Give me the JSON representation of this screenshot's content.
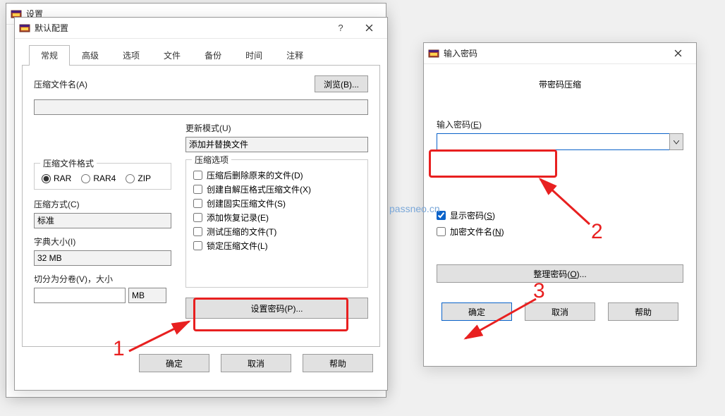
{
  "watermark": "passneo.cn",
  "settings_window": {
    "title": "设置"
  },
  "default_window": {
    "title": "默认配置",
    "tabs": [
      "常规",
      "高级",
      "选项",
      "文件",
      "备份",
      "时间",
      "注释"
    ],
    "active_tab": 0,
    "archive_name_label": "压缩文件名(A)",
    "browse_btn": "浏览(B)...",
    "update_mode_label": "更新模式(U)",
    "update_mode_value": "添加并替换文件",
    "format_legend": "压缩文件格式",
    "formats": [
      "RAR",
      "RAR4",
      "ZIP"
    ],
    "format_selected": "RAR",
    "method_label": "压缩方式(C)",
    "method_value": "标准",
    "dict_label": "字典大小(I)",
    "dict_value": "32 MB",
    "split_label": "切分为分卷(V)，大小",
    "split_unit": "MB",
    "options_legend": "压缩选项",
    "options": [
      "压缩后删除原来的文件(D)",
      "创建自解压格式压缩文件(X)",
      "创建固实压缩文件(S)",
      "添加恢复记录(E)",
      "测试压缩的文件(T)",
      "锁定压缩文件(L)"
    ],
    "set_password_btn": "设置密码(P)...",
    "ok_btn": "确定",
    "cancel_btn": "取消",
    "help_btn": "帮助"
  },
  "pwd_window": {
    "title": "输入密码",
    "heading": "带密码压缩",
    "enter_label_prefix": "输入密码(",
    "enter_label_u": "E",
    "enter_label_suffix": ")",
    "show_prefix": "显示密码(",
    "show_u": "S",
    "show_suffix": ")",
    "encrypt_prefix": "加密文件名(",
    "encrypt_u": "N",
    "encrypt_suffix": ")",
    "organize_prefix": "整理密码(",
    "organize_u": "O",
    "organize_suffix": ")...",
    "ok_btn": "确定",
    "cancel_btn": "取消",
    "help_btn": "帮助"
  },
  "annotations": {
    "n1": "1",
    "n2": "2",
    "n3": "3"
  }
}
